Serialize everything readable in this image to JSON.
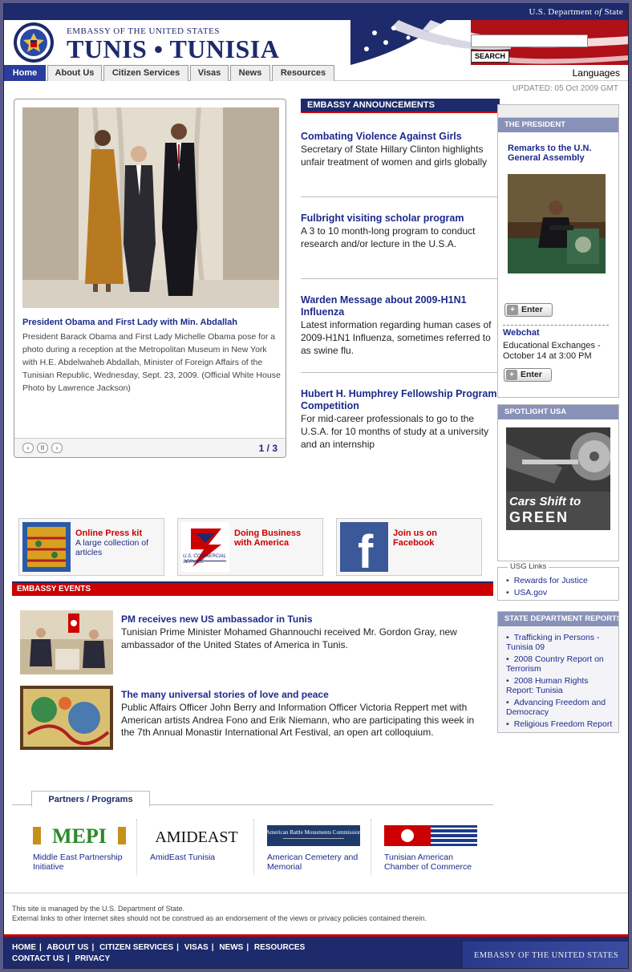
{
  "topbar": {
    "dept_prefix": "U.S. Department ",
    "dept_of": "of",
    "dept_suffix": " State"
  },
  "header": {
    "pre_title": "EMBASSY OF THE UNITED STATES",
    "title": "TUNIS • TUNISIA",
    "seal_text": "UNITED STATES OF AMERICA EMBASSY",
    "search_button": "SEARCH",
    "search_value": ""
  },
  "nav": {
    "tabs": [
      "Home",
      "About Us",
      "Citizen Services",
      "Visas",
      "News",
      "Resources"
    ],
    "active": "Home",
    "languages": "Languages",
    "updated": "UPDATED: 05 Oct 2009 GMT"
  },
  "slideshow": {
    "caption_title": "President Obama and First Lady with Min. Abdallah",
    "caption_text": "President Barack Obama and First Lady Michelle Obama pose for a photo during a reception at the Metropolitan Museum in New York with H.E. Abdelwaheb Abdallah, Minister of Foreign Affairs of the Tunisian Republic, Wednesday, Sept. 23, 2009. (Official White House Photo by Lawrence Jackson)",
    "counter": "1 / 3",
    "controls": [
      "‹",
      "II",
      "›"
    ]
  },
  "announcements": {
    "header": "EMBASSY ANNOUNCEMENTS",
    "items": [
      {
        "title": "Combating Violence Against Girls",
        "text": "Secretary of State Hillary Clinton highlights unfair treatment of women and girls globally"
      },
      {
        "title": "Fulbright visiting scholar program",
        "text": "A 3 to 10 month-long program to conduct research and/or lecture in the U.S.A."
      },
      {
        "title": "Warden Message about 2009-H1N1 Influenza",
        "text": "Latest information regarding human cases of 2009-H1N1 Influenza, sometimes referred to as swine flu."
      },
      {
        "title": "Hubert H. Humphrey Fellowship Program Competition",
        "text": "For mid-career professionals to go to the U.S.A. for 10 months of study at a university and an internship"
      }
    ]
  },
  "president": {
    "header": "THE PRESIDENT",
    "title": "Remarks to the U.N. General Assembly",
    "enter": "Enter",
    "webchat_title": "Webchat",
    "webchat_text": "Educational Exchanges - October 14 at 3:00 PM",
    "enter2": "Enter"
  },
  "spotlight": {
    "header": "SPOTLIGHT USA",
    "img_line1": "Cars Shift to",
    "img_line2": "GREEN"
  },
  "usg_links": {
    "title": "USG Links",
    "items": [
      "Rewards for Justice",
      "USA.gov"
    ]
  },
  "state_reports": {
    "header": "STATE DEPARTMENT REPORTS",
    "items": [
      "Trafficking in Persons - Tunisia 09",
      "2008 Country Report on Terrorism",
      "2008 Human Rights Report: Tunisia",
      "Advancing Freedom and Democracy",
      "Religious Freedom Report"
    ]
  },
  "promos": [
    {
      "title": "Online Press kit",
      "desc": "A large collection of articles"
    },
    {
      "title": "Doing Business with America",
      "desc": "",
      "logo_text": "U.S. COMMERCIAL SERVICE"
    },
    {
      "title": "Join us on Facebook",
      "desc": "",
      "logo_text": "f"
    }
  ],
  "events": {
    "header": "EMBASSY EVENTS",
    "items": [
      {
        "title": "PM receives new US ambassador in Tunis",
        "text": "Tunisian Prime Minister Mohamed Ghannouchi received Mr. Gordon Gray, new ambassador of the United States of America in Tunis."
      },
      {
        "title": "The many universal stories of love and peace",
        "text": "Public Affairs Officer John Berry and Information Officer Victoria Reppert met with American artists Andrea Fono and Erik Niemann, who are participating this week in the 7th Annual Monastir International Art Festival, an open art colloquium."
      }
    ]
  },
  "partners": {
    "title": "Partners / Programs",
    "items": [
      {
        "logo": "MEPI",
        "name": "Middle East Partnership Initiative"
      },
      {
        "logo": "AMIDEAST",
        "name": "AmidEast Tunisia"
      },
      {
        "logo": "American Battle Monuments Commission",
        "name": "American Cemetery and Memorial"
      },
      {
        "logo": "",
        "name": "Tunisian American Chamber of Commerce"
      }
    ]
  },
  "footer": {
    "note1": "This site is managed by the U.S. Department of State.",
    "note2": "External links to other Internet sites should not be construed as an endorsement of the views or privacy policies contained therein.",
    "links_row1": [
      "HOME",
      "ABOUT US",
      "CITIZEN SERVICES",
      "VISAS",
      "NEWS",
      "RESOURCES"
    ],
    "links_row2": [
      "CONTACT US",
      "PRIVACY"
    ],
    "embassy": "EMBASSY OF THE UNITED STATES"
  },
  "colors": {
    "navy": "#1d2a6b",
    "red": "#cc0000",
    "link": "#1d2a8b"
  }
}
